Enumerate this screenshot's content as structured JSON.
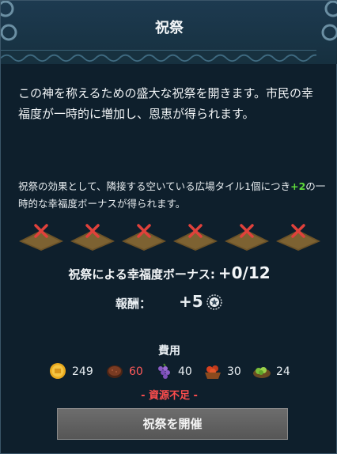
{
  "dialog": {
    "title": "祝祭",
    "intro": "この神を称えるための盛大な祝祭を開きます。市民の幸福度が一時的に増加し、恩恵が得られます。",
    "effect_before": "祝祭の効果として、隣接する空いている広場タイル1個につき",
    "effect_value": "+2",
    "effect_after": "の一時的な幸福度ボーナスが得られます。",
    "tiles": [
      {
        "state": "unavailable"
      },
      {
        "state": "unavailable"
      },
      {
        "state": "unavailable"
      },
      {
        "state": "unavailable"
      },
      {
        "state": "unavailable"
      },
      {
        "state": "unavailable"
      }
    ],
    "bonus_label": "祝祭による幸福度ボーナス:",
    "bonus_value": "+0/12",
    "reward_label": "報酬：",
    "reward_value": "+5",
    "reward_icon": "favor-icon",
    "cost_title": "費用",
    "costs": [
      {
        "icon": "gold-coin-icon",
        "amount": "249",
        "insufficient": false
      },
      {
        "icon": "meat-icon",
        "amount": "60",
        "insufficient": true
      },
      {
        "icon": "grapes-icon",
        "amount": "40",
        "insufficient": false
      },
      {
        "icon": "fruit-basket-icon",
        "amount": "30",
        "insufficient": false
      },
      {
        "icon": "vegetables-icon",
        "amount": "24",
        "insufficient": false
      }
    ],
    "warning": "- 資源不足 -",
    "button_label": "祝祭を開催",
    "colors": {
      "bonus_green": "#5fdc3a",
      "shortage_red": "#ff4d4d",
      "tile_x_red": "#e0413b"
    }
  }
}
